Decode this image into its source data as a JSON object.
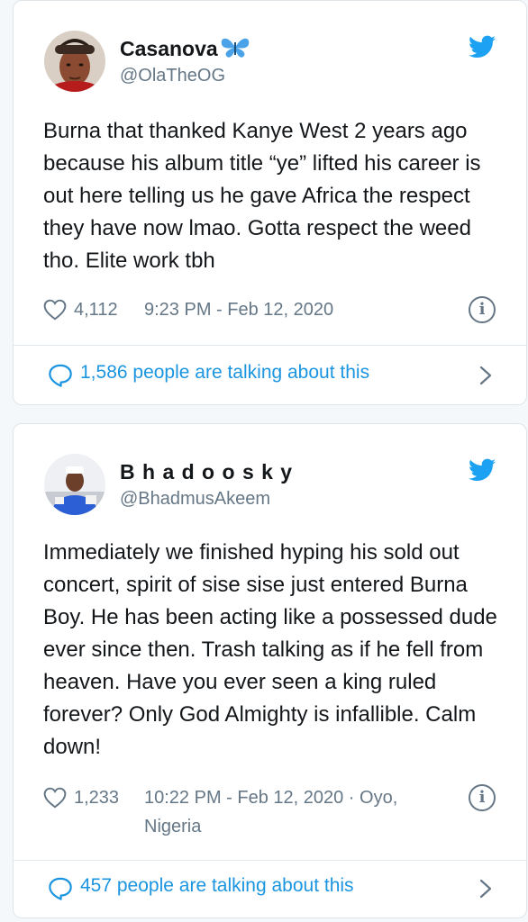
{
  "tweets": [
    {
      "display_name": "Casanova",
      "name_emoji": "butterfly-emoji",
      "handle": "@OlaTheOG",
      "text": "Burna that thanked Kanye West 2 years ago because his album title “ye” lifted his career is out here telling us he gave Africa the respect they have now lmao. Gotta respect the weed tho. Elite work tbh",
      "likes": "4,112",
      "timestamp": "9:23 PM - Feb 12, 2020",
      "talking": "1,586 people are talking about this"
    },
    {
      "display_name": "B h a d o o s k y",
      "handle": "@BhadmusAkeem",
      "text": "Immediately we finished hyping his sold out concert, spirit of sise sise just entered Burna Boy. He has been acting like a possessed dude ever since then. Trash talking as if he fell from heaven. Have you ever seen a king ruled forever? Only God Almighty is infallible. Calm down!",
      "likes": "1,233",
      "timestamp_line1": "10:22 PM - Feb 12, 2020 · Oyo,",
      "timestamp_line2": "Nigeria",
      "talking": "457 people are talking about this"
    }
  ],
  "icons": {
    "platform": "twitter-bird-icon",
    "like": "heart-icon",
    "info": "info-icon",
    "conversation": "speech-bubble-icon",
    "more": "chevron-right-icon"
  },
  "colors": {
    "twitter_blue": "#1da1f2",
    "link_blue": "#1b95e0",
    "secondary_text": "#657786",
    "primary_text": "#14171a"
  },
  "info_glyph": "i"
}
